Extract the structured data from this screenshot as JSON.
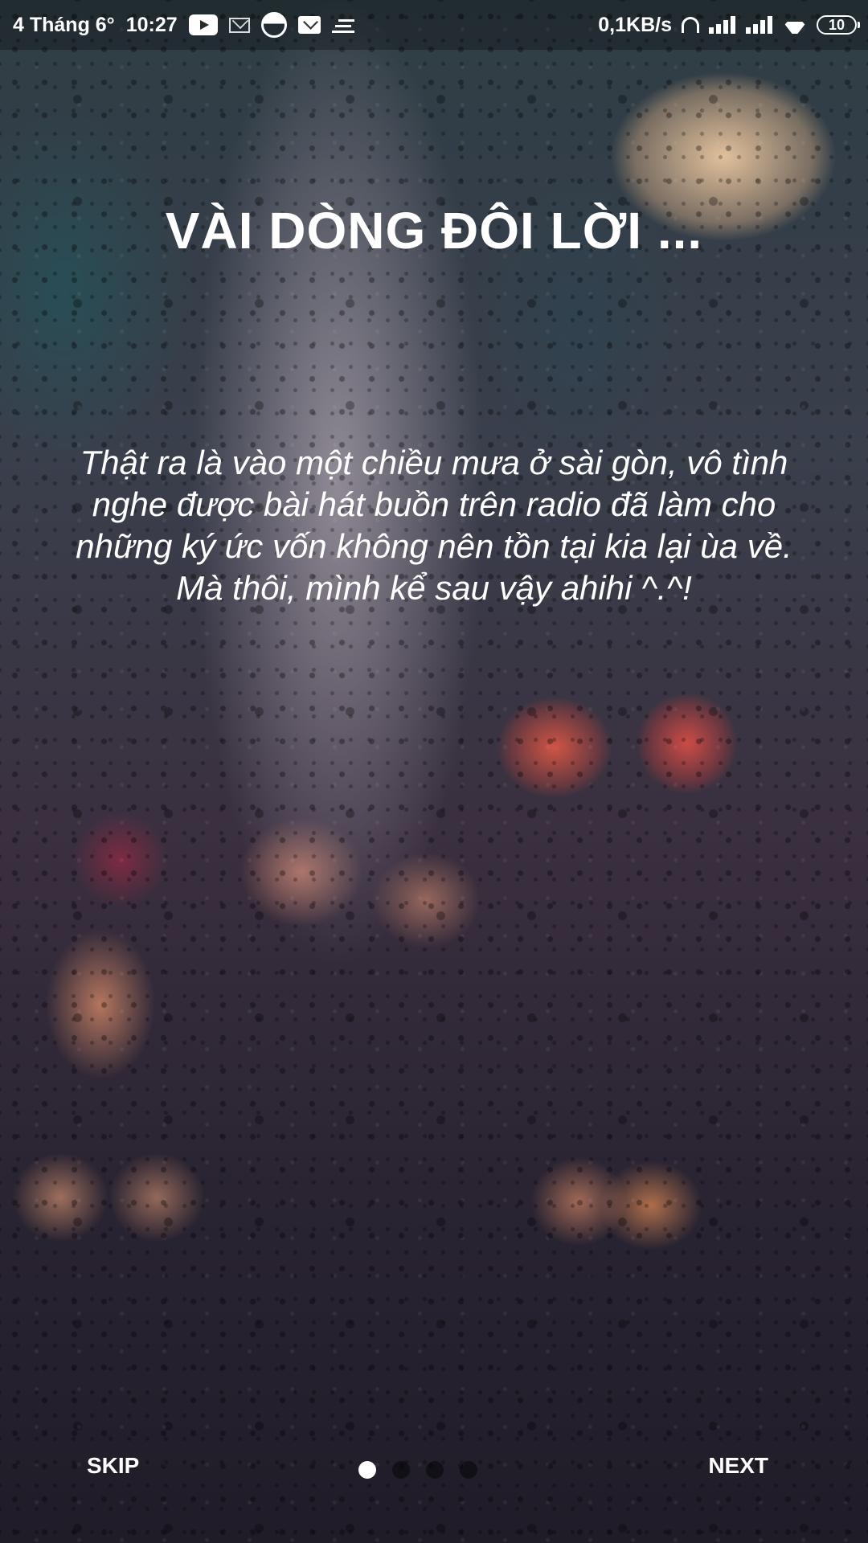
{
  "status_bar": {
    "date": "4 Tháng 6°",
    "time": "10:27",
    "speed": "0,1KB/s",
    "battery": "10",
    "icons": [
      "youtube-icon",
      "mail-outline-icon",
      "round-app-icon",
      "gmail-icon",
      "lines-icon",
      "headphones-icon",
      "signal-icon",
      "signal-icon",
      "wifi-icon",
      "battery-icon"
    ]
  },
  "onboarding": {
    "title": "VÀI DÒNG ĐÔI LỜI ...",
    "body": "Thật ra là vào một chiều mưa ở sài gòn, vô tình nghe được bài hát buồn trên radio đã làm cho những ký ức vốn không nên tồn tại kia lại ùa về. Mà thôi, mình kể sau vậy ahihi ^.^!",
    "page_count": 4,
    "current_page": 1
  },
  "nav": {
    "skip_label": "SKIP",
    "next_label": "NEXT"
  },
  "colors": {
    "text": "#ffffff",
    "active_dot": "#ffffff",
    "inactive_dot": "#1a1a1a"
  }
}
